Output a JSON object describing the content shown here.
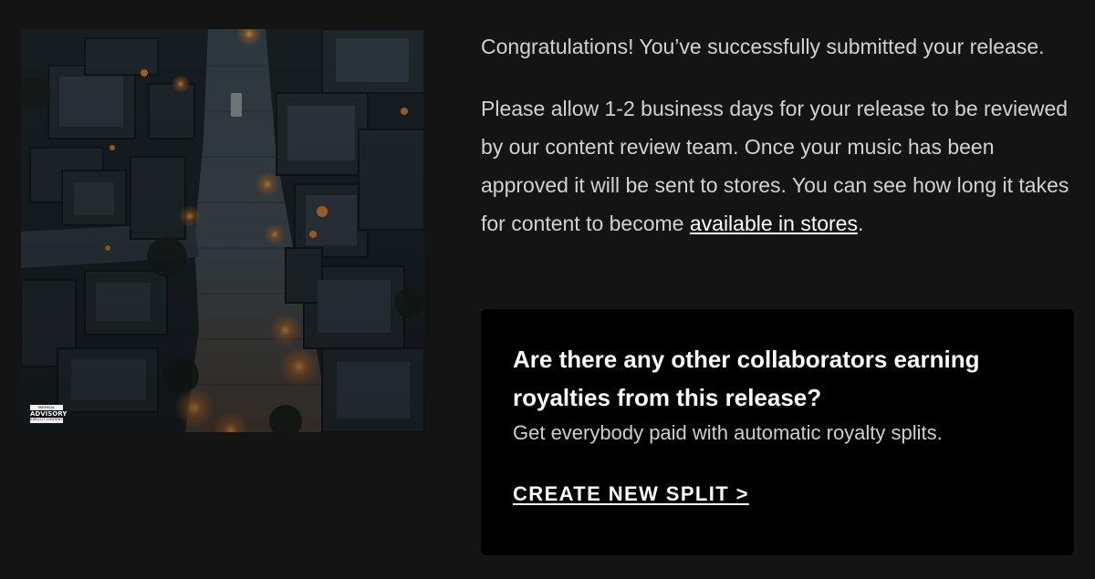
{
  "artwork": {
    "alt": "Aerial night view of a narrow stone street between dark rooftops lit by warm lanterns",
    "advisory_label": {
      "top": "PARENTAL",
      "middle": "ADVISORY",
      "bottom": "EXPLICIT CONTENT"
    }
  },
  "confirmation": {
    "intro": "Congratulations! You’ve successfully submitted your release.",
    "details_before_link": "Please allow 1-2 business days for your release to be reviewed by our content review team. Once your music has been approved it will be sent to stores. You can see how long it takes for content to become ",
    "details_link": "available in stores",
    "details_after_link": "."
  },
  "split_card": {
    "title": "Are there any other collaborators earning royalties from this release?",
    "subtitle": "Get everybody paid with automatic royalty splits.",
    "cta": "CREATE NEW SPLIT >"
  },
  "colors": {
    "page_background": "#141414",
    "card_background": "#000000",
    "body_text": "#d2d2d2",
    "heading_text": "#ffffff"
  }
}
